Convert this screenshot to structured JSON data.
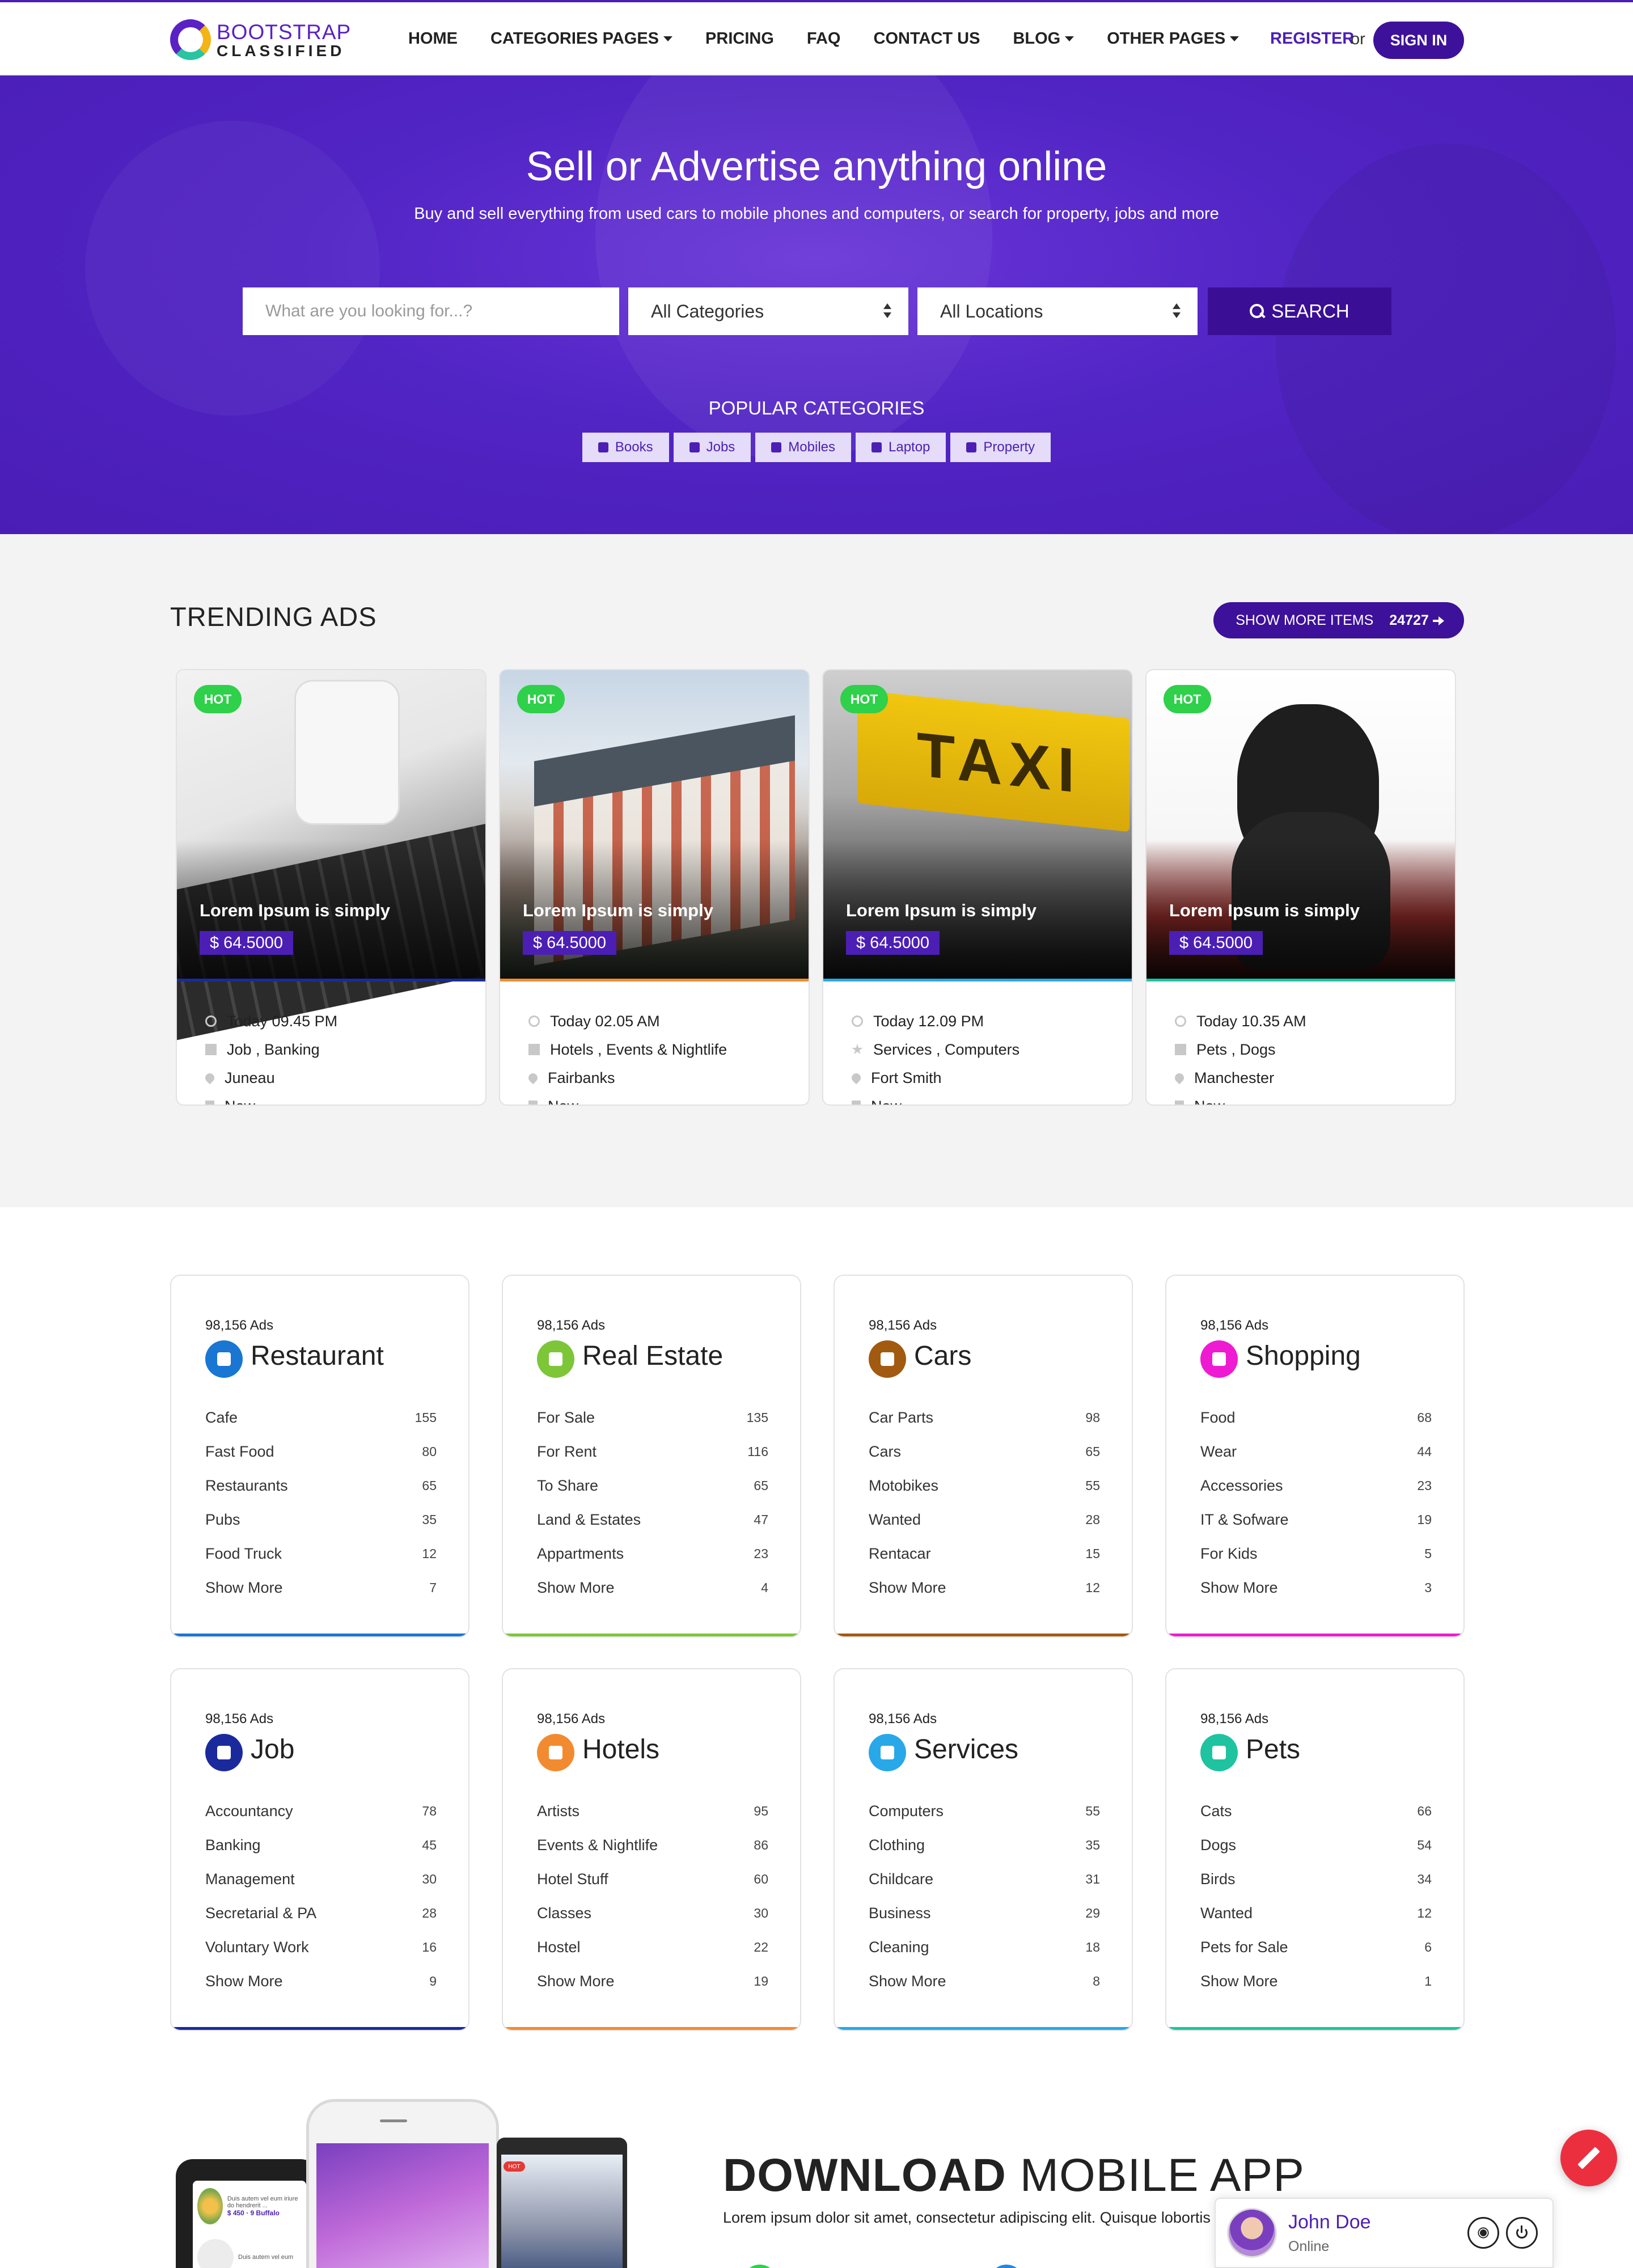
{
  "brand": {
    "top": "BOOTSTRAP",
    "bottom": "CLASSIFIED"
  },
  "nav": {
    "items": [
      "HOME",
      "CATEGORIES PAGES",
      "PRICING",
      "FAQ",
      "CONTACT US",
      "BLOG",
      "OTHER PAGES"
    ],
    "register": "REGISTER",
    "or": "or",
    "signin": "SIGN IN"
  },
  "hero": {
    "title": "Sell or Advertise anything online",
    "subtitle": "Buy and sell everything from used cars to mobile phones and computers, or search for property, jobs and more",
    "search_placeholder": "What are you looking for...?",
    "category_select": "All Categories",
    "location_select": "All Locations",
    "search_button": "SEARCH",
    "popular_title": "POPULAR CATEGORIES",
    "popular": [
      "Books",
      "Jobs",
      "Mobiles",
      "Laptop",
      "Property"
    ]
  },
  "trending": {
    "title": "TRENDING ADS",
    "show_more": "SHOW MORE ITEMS",
    "count": "24727",
    "ads": [
      {
        "badge": "HOT",
        "title": "Lorem Ipsum is simply",
        "price": "$ 64.5000",
        "time": "Today 09.45 PM",
        "category": "Job , Banking",
        "location": "Juneau",
        "condition": "New",
        "accent": "#1a2a9c"
      },
      {
        "badge": "HOT",
        "title": "Lorem Ipsum is simply",
        "price": "$ 64.5000",
        "time": "Today 02.05 AM",
        "category": "Hotels , Events & Nightlife",
        "location": "Fairbanks",
        "condition": "New",
        "accent": "#f28b30"
      },
      {
        "badge": "HOT",
        "title": "Lorem Ipsum is simply",
        "price": "$ 64.5000",
        "time": "Today 12.09 PM",
        "category": "Services , Computers",
        "location": "Fort Smith",
        "condition": "New",
        "accent": "#28a8e8"
      },
      {
        "badge": "HOT",
        "title": "Lorem Ipsum is simply",
        "price": "$ 64.5000",
        "time": "Today 10.35 AM",
        "category": "Pets , Dogs",
        "location": "Manchester",
        "condition": "New",
        "accent": "#1fc3a0"
      }
    ]
  },
  "categories": [
    {
      "ads": "98,156 Ads",
      "name": "Restaurant",
      "color": "#1976d2",
      "icon": "cocktail-icon",
      "items": [
        [
          "Cafe",
          "155"
        ],
        [
          "Fast Food",
          "80"
        ],
        [
          "Restaurants",
          "65"
        ],
        [
          "Pubs",
          "35"
        ],
        [
          "Food Truck",
          "12"
        ],
        [
          "Show More",
          "7"
        ]
      ]
    },
    {
      "ads": "98,156 Ads",
      "name": "Real Estate",
      "color": "#7cc638",
      "icon": "home-icon",
      "items": [
        [
          "For Sale",
          "135"
        ],
        [
          "For Rent",
          "116"
        ],
        [
          "To Share",
          "65"
        ],
        [
          "Land & Estates",
          "47"
        ],
        [
          "Appartments",
          "23"
        ],
        [
          "Show More",
          "4"
        ]
      ]
    },
    {
      "ads": "98,156 Ads",
      "name": "Cars",
      "color": "#a25a10",
      "icon": "car-icon",
      "items": [
        [
          "Car Parts",
          "98"
        ],
        [
          "Cars",
          "65"
        ],
        [
          "Motobikes",
          "55"
        ],
        [
          "Wanted",
          "28"
        ],
        [
          "Rentacar",
          "15"
        ],
        [
          "Show More",
          "12"
        ]
      ]
    },
    {
      "ads": "98,156 Ads",
      "name": "Shopping",
      "color": "#ee1bd2",
      "icon": "cart-icon",
      "items": [
        [
          "Food",
          "68"
        ],
        [
          "Wear",
          "44"
        ],
        [
          "Accessories",
          "23"
        ],
        [
          "IT & Sofware",
          "19"
        ],
        [
          "For Kids",
          "5"
        ],
        [
          "Show More",
          "3"
        ]
      ]
    },
    {
      "ads": "98,156 Ads",
      "name": "Job",
      "color": "#1a2a9c",
      "icon": "briefcase-icon",
      "items": [
        [
          "Accountancy",
          "78"
        ],
        [
          "Banking",
          "45"
        ],
        [
          "Management",
          "30"
        ],
        [
          "Secretarial & PA",
          "28"
        ],
        [
          "Voluntary Work",
          "16"
        ],
        [
          "Show More",
          "9"
        ]
      ]
    },
    {
      "ads": "98,156 Ads",
      "name": "Hotels",
      "color": "#f28b30",
      "icon": "building-icon",
      "items": [
        [
          "Artists",
          "95"
        ],
        [
          "Events & Nightlife",
          "86"
        ],
        [
          "Hotel Stuff",
          "60"
        ],
        [
          "Classes",
          "30"
        ],
        [
          "Hostel",
          "22"
        ],
        [
          "Show More",
          "19"
        ]
      ]
    },
    {
      "ads": "98,156 Ads",
      "name": "Services",
      "color": "#28a8e8",
      "icon": "star-icon",
      "items": [
        [
          "Computers",
          "55"
        ],
        [
          "Clothing",
          "35"
        ],
        [
          "Childcare",
          "31"
        ],
        [
          "Business",
          "29"
        ],
        [
          "Cleaning",
          "18"
        ],
        [
          "Show More",
          "8"
        ]
      ]
    },
    {
      "ads": "98,156 Ads",
      "name": "Pets",
      "color": "#1fc3a0",
      "icon": "paw-icon",
      "items": [
        [
          "Cats",
          "66"
        ],
        [
          "Dogs",
          "54"
        ],
        [
          "Birds",
          "34"
        ],
        [
          "Wanted",
          "12"
        ],
        [
          "Pets for Sale",
          "6"
        ],
        [
          "Show More",
          "1"
        ]
      ]
    }
  ],
  "download": {
    "bold": "DOWNLOAD",
    "light": "MOBILE APP",
    "text": "Lorem ipsum dolor sit amet, consectetur adipiscing elit. Quisque lobortis",
    "phone_text_1": "Duis autem vel eum iriure do hendrerit ...",
    "phone_price": "$ 450 · 9 Buffalo",
    "phone_text_2": "Duis autem vel eum",
    "tablet_badge": "HOT"
  },
  "chat": {
    "name": "John Doe",
    "status": "Online"
  }
}
